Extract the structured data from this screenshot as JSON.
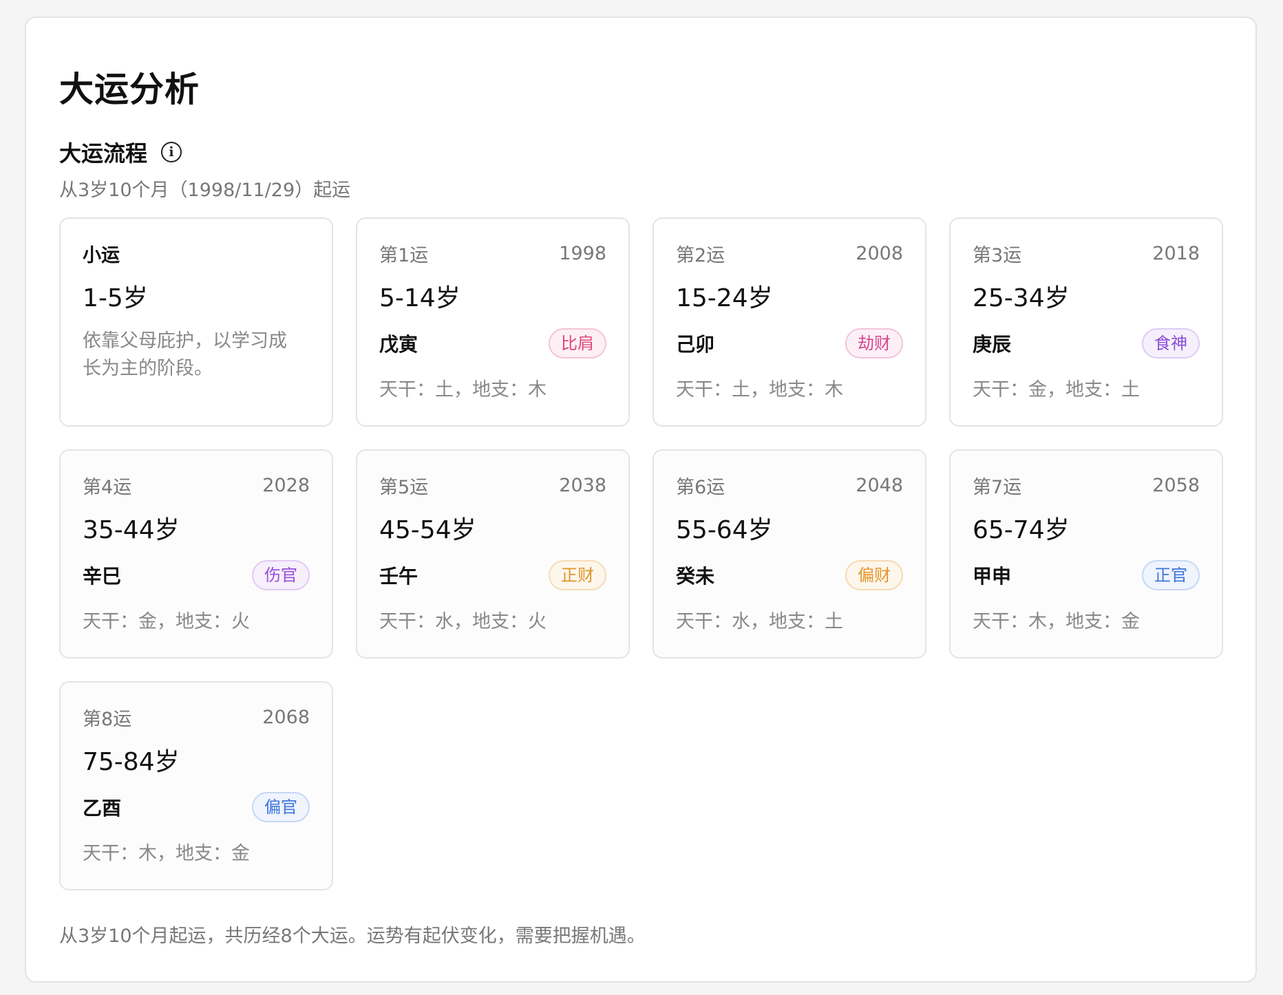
{
  "title": "大运分析",
  "section": {
    "title": "大运流程",
    "info_icon": "info-icon",
    "subtitle": "从3岁10个月（1998/11/29）起运"
  },
  "minor": {
    "label": "小运",
    "age": "1-5岁",
    "description": "依靠父母庇护，以学习成长为主的阶段。"
  },
  "cycles": [
    {
      "label": "第1运",
      "year": "1998",
      "age": "5-14岁",
      "ganzhi": "戊寅",
      "god": "比肩",
      "color": "#e0457b",
      "bg": "#fdf0f4",
      "border": "#f6c3d4",
      "wuxing": "天干：土，地支：木"
    },
    {
      "label": "第2运",
      "year": "2008",
      "age": "15-24岁",
      "ganzhi": "己卯",
      "god": "劫财",
      "color": "#d6458f",
      "bg": "#fcf0f6",
      "border": "#f3c2dc",
      "wuxing": "天干：土，地支：木"
    },
    {
      "label": "第3运",
      "year": "2018",
      "age": "25-34岁",
      "ganzhi": "庚辰",
      "god": "食神",
      "color": "#8a4fd8",
      "bg": "#f6f0fd",
      "border": "#dccbf5",
      "wuxing": "天干：金，地支：土"
    },
    {
      "label": "第4运",
      "year": "2028",
      "age": "35-44岁",
      "ganzhi": "辛巳",
      "god": "伤官",
      "color": "#9b4fd4",
      "bg": "#f7effc",
      "border": "#e2c9f4",
      "wuxing": "天干：金，地支：火"
    },
    {
      "label": "第5运",
      "year": "2038",
      "age": "45-54岁",
      "ganzhi": "壬午",
      "god": "正财",
      "color": "#e0962a",
      "bg": "#fdf6ec",
      "border": "#f6dcb4",
      "wuxing": "天干：水，地支：火"
    },
    {
      "label": "第6运",
      "year": "2048",
      "age": "55-64岁",
      "ganzhi": "癸未",
      "god": "偏财",
      "color": "#e6952a",
      "bg": "#fdf6ec",
      "border": "#f6dab0",
      "wuxing": "天干：水，地支：土"
    },
    {
      "label": "第7运",
      "year": "2058",
      "age": "65-74岁",
      "ganzhi": "甲申",
      "god": "正官",
      "color": "#3f74d8",
      "bg": "#eff4fd",
      "border": "#c6d7f5",
      "wuxing": "天干：木，地支：金"
    },
    {
      "label": "第8运",
      "year": "2068",
      "age": "75-84岁",
      "ganzhi": "乙酉",
      "god": "偏官",
      "color": "#3f74d8",
      "bg": "#eff4fd",
      "border": "#c6d7f5",
      "wuxing": "天干：木，地支：金"
    }
  ],
  "summary": "从3岁10个月起运，共历经8个大运。运势有起伏变化，需要把握机遇。"
}
